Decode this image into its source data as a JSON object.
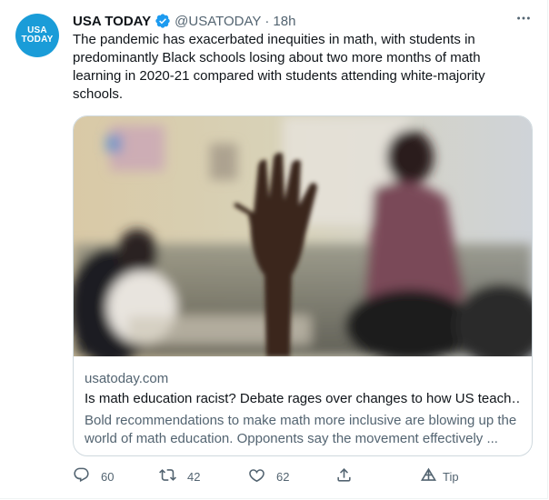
{
  "account": {
    "avatar_line1": "USA",
    "avatar_line2": "TODAY",
    "name": "USA TODAY",
    "handle": "@USATODAY",
    "separator": "·",
    "time": "18h"
  },
  "tweet": {
    "text_lines": [
      "The pandemic has exacerbated inequities in math, with students in",
      "predominantly Black schools losing about two more months of math",
      "learning in 2020-21 compared with students attending white-majority",
      "schools."
    ]
  },
  "card": {
    "domain": "usatoday.com",
    "title": "Is math education racist? Debate rages over changes to how US teach…",
    "description_lines": [
      "Bold recommendations to make math more inclusive are blowing up the",
      "world of math education. Opponents say the movement effectively ..."
    ]
  },
  "actions": {
    "replies": "60",
    "retweets": "42",
    "likes": "62",
    "tip_label": "Tip"
  },
  "colors": {
    "brand": "#1a9cd8",
    "text_primary": "#0f1419",
    "text_secondary": "#536471",
    "verified": "#1d9bf0",
    "border": "#cfd9de"
  }
}
